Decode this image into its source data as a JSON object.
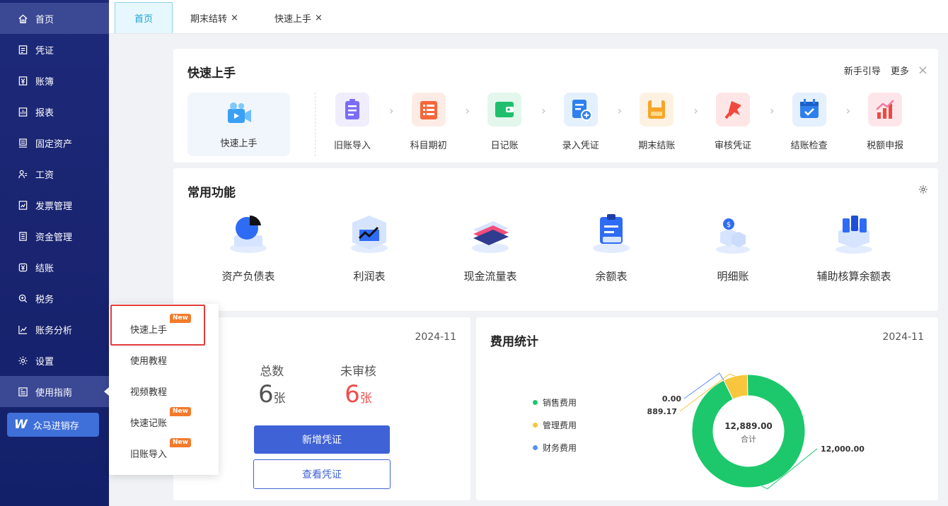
{
  "sidebar": {
    "items": [
      {
        "label": "首页",
        "icon": "home-icon"
      },
      {
        "label": "凭证",
        "icon": "voucher-icon"
      },
      {
        "label": "账簿",
        "icon": "ledger-icon"
      },
      {
        "label": "报表",
        "icon": "report-icon"
      },
      {
        "label": "固定资产",
        "icon": "asset-icon"
      },
      {
        "label": "工资",
        "icon": "salary-icon"
      },
      {
        "label": "发票管理",
        "icon": "invoice-icon"
      },
      {
        "label": "资金管理",
        "icon": "fund-icon"
      },
      {
        "label": "结账",
        "icon": "closing-icon"
      },
      {
        "label": "税务",
        "icon": "tax-icon"
      },
      {
        "label": "账务分析",
        "icon": "analysis-icon"
      },
      {
        "label": "设置",
        "icon": "gear-icon"
      },
      {
        "label": "使用指南",
        "icon": "guide-icon"
      }
    ],
    "erp_label": "众马进销存"
  },
  "tabs": [
    {
      "label": "首页"
    },
    {
      "label": "期末结转",
      "close": "×"
    },
    {
      "label": "快速上手",
      "close": "×"
    }
  ],
  "quick_start": {
    "title": "快速上手",
    "guide_link": "新手引导",
    "more_link": "更多",
    "close": "×",
    "main_label": "快速上手",
    "steps": [
      {
        "label": "旧账导入",
        "color": "#7b6cf6",
        "bg": "#efedfe"
      },
      {
        "label": "科目期初",
        "color": "#f5663a",
        "bg": "#fdece6"
      },
      {
        "label": "日记账",
        "color": "#1fbf6e",
        "bg": "#e3f7ec"
      },
      {
        "label": "录入凭证",
        "color": "#2f80ed",
        "bg": "#e5f0fd"
      },
      {
        "label": "期末结账",
        "color": "#f7a52a",
        "bg": "#fdf2e1"
      },
      {
        "label": "审核凭证",
        "color": "#f0483e",
        "bg": "#fde6e5"
      },
      {
        "label": "结账检查",
        "color": "#2f80ed",
        "bg": "#e5f0fd"
      },
      {
        "label": "税额申报",
        "color": "#f0483e",
        "bg": "#fde6ea"
      }
    ]
  },
  "common_functions": {
    "title": "常用功能",
    "items": [
      {
        "label": "资产负债表"
      },
      {
        "label": "利润表"
      },
      {
        "label": "现金流量表"
      },
      {
        "label": "余额表"
      },
      {
        "label": "明细账"
      },
      {
        "label": "辅助核算余额表"
      }
    ]
  },
  "voucher_stats": {
    "date": "2024-11",
    "total_label": "总数",
    "total_value": "6",
    "total_unit": "张",
    "unreviewed_label": "未审核",
    "unreviewed_value": "6",
    "unreviewed_unit": "张",
    "add_button": "新增凭证",
    "view_button": "查看凭证"
  },
  "expense_stats": {
    "title": "费用统计",
    "date": "2024-11",
    "center_value": "12,889.00",
    "center_label": "合计",
    "legend": [
      {
        "label": "销售费用",
        "color": "#1cc86b"
      },
      {
        "label": "管理费用",
        "color": "#f7c63c"
      },
      {
        "label": "财务费用",
        "color": "#5b8ff9"
      }
    ]
  },
  "chart_data": {
    "type": "pie",
    "categories": [
      "销售费用",
      "管理费用",
      "财务费用"
    ],
    "values": [
      12000.0,
      889.17,
      0.0
    ],
    "labels": [
      "12,000.00",
      "889.17",
      "0.00"
    ],
    "total": "12,889.00",
    "total_label": "合计",
    "colors": [
      "#1cc86b",
      "#f7c63c",
      "#5b8ff9"
    ]
  },
  "popup_menu": {
    "items": [
      {
        "label": "快速上手",
        "badge": "New"
      },
      {
        "label": "使用教程"
      },
      {
        "label": "视频教程"
      },
      {
        "label": "快速记账",
        "badge": "New"
      },
      {
        "label": "旧账导入",
        "badge": "New"
      }
    ]
  }
}
